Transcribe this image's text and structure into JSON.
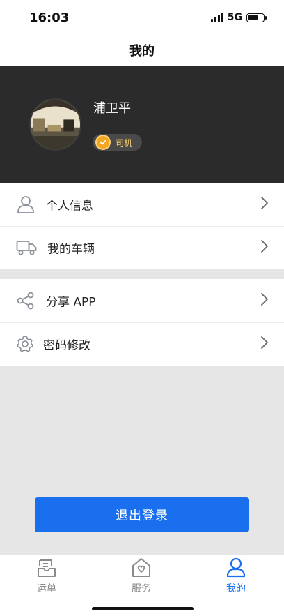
{
  "status_bar": {
    "time": "16:03",
    "network": "5G"
  },
  "nav": {
    "title": "我的"
  },
  "profile": {
    "name": "浦卫平",
    "role": "司机"
  },
  "menu": {
    "group1": [
      {
        "label": "个人信息",
        "icon": "person-icon"
      },
      {
        "label": "我的车辆",
        "icon": "truck-icon"
      }
    ],
    "group2": [
      {
        "label": "分享 APP",
        "icon": "share-icon"
      },
      {
        "label": "密码修改",
        "icon": "gear-icon"
      }
    ]
  },
  "logout_label": "退出登录",
  "tabs": [
    {
      "label": "运单",
      "icon": "waybill-icon",
      "active": false
    },
    {
      "label": "服务",
      "icon": "service-home-icon",
      "active": false
    },
    {
      "label": "我的",
      "icon": "profile-icon",
      "active": true
    }
  ],
  "colors": {
    "accent": "#1a6fef",
    "header_bg": "#2b2b2b",
    "badge": "#f5a623",
    "page_bg": "#e6e6e6"
  }
}
